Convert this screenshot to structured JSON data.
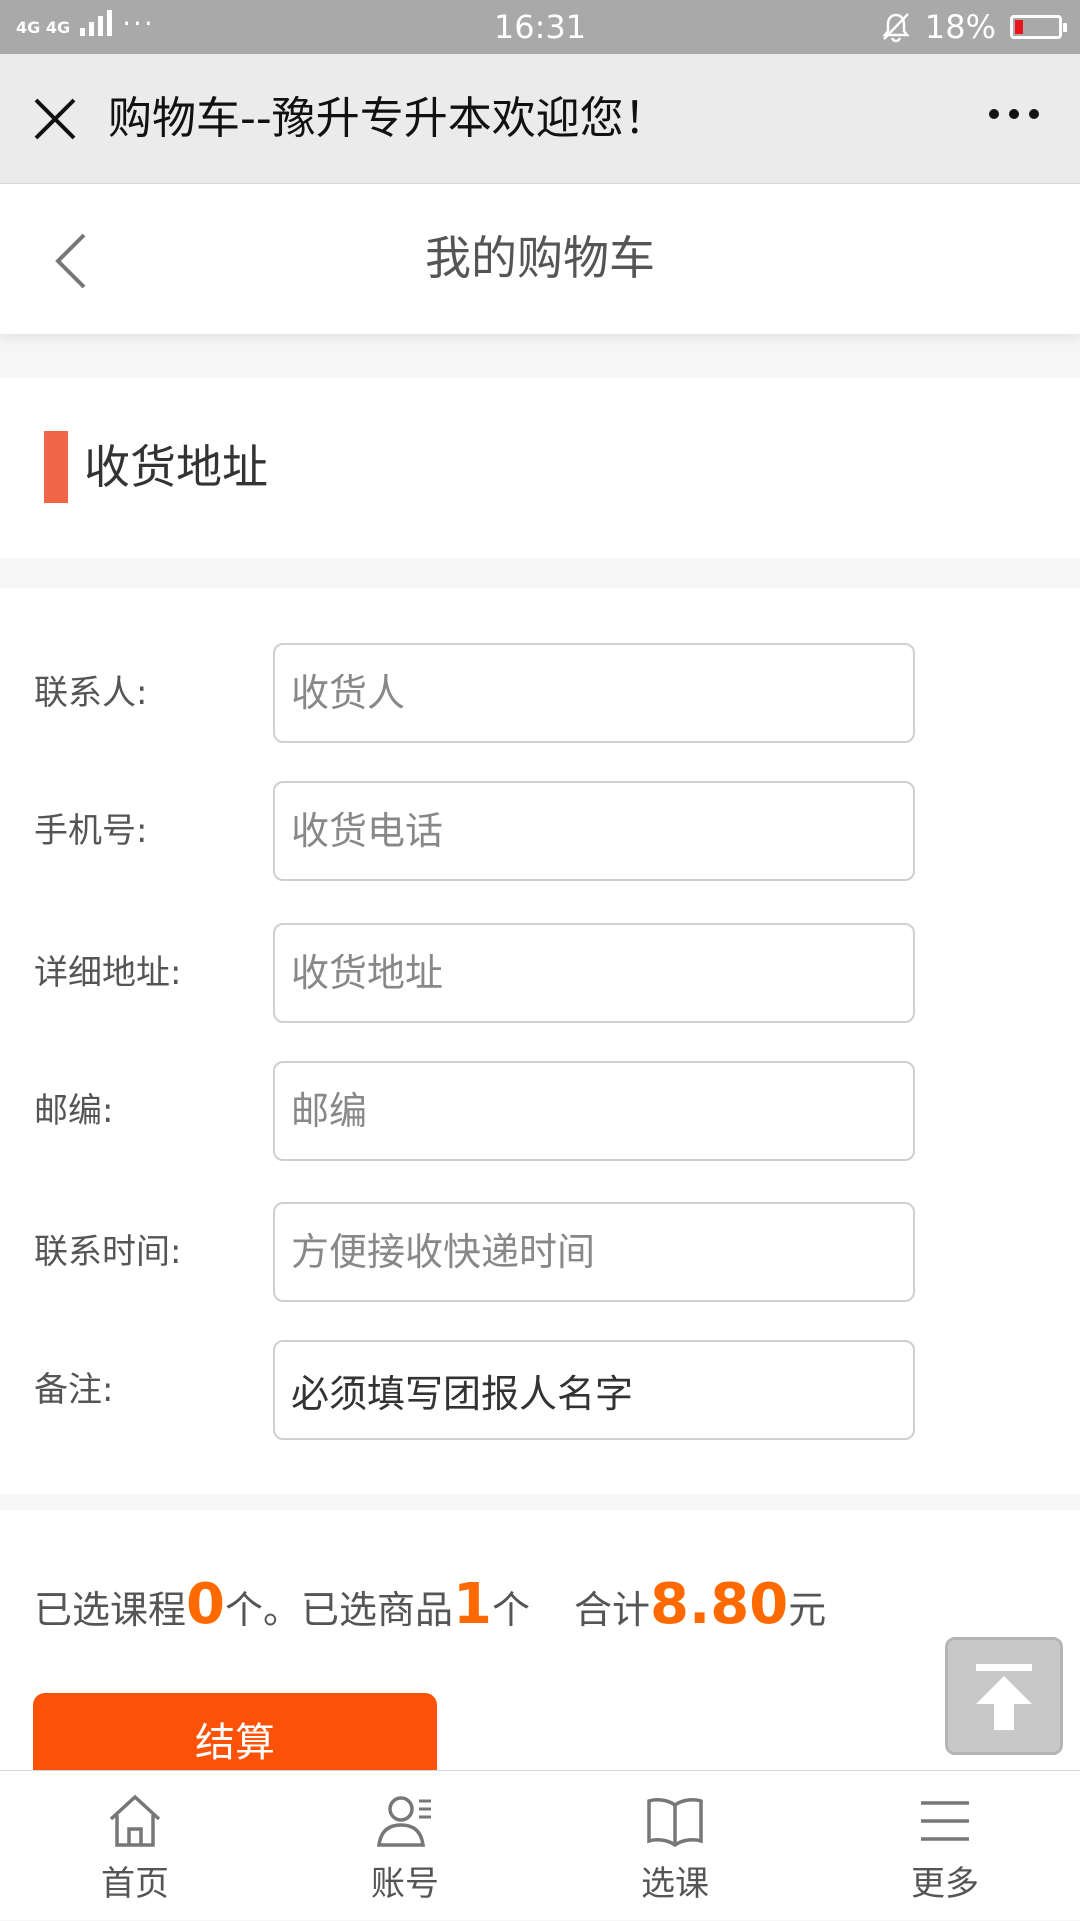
{
  "status_bar": {
    "network": "4G 4G",
    "more": "···",
    "time": "16:31",
    "battery_pct": "18%",
    "battery_level": 0.18
  },
  "titlebar": {
    "title": "购物车--豫升专升本欢迎您！"
  },
  "header": {
    "title": "我的购物车"
  },
  "section": {
    "title": "收货地址",
    "accent_color": "#ef6746"
  },
  "form": {
    "fields": [
      {
        "label": "联系人:",
        "placeholder": "收货人",
        "value": ""
      },
      {
        "label": "手机号:",
        "placeholder": "收货电话",
        "value": ""
      },
      {
        "label": "详细地址:",
        "placeholder": "收货地址",
        "value": ""
      },
      {
        "label": "邮编:",
        "placeholder": "邮编",
        "value": ""
      },
      {
        "label": "联系时间:",
        "placeholder": "方便接收快递时间",
        "value": ""
      },
      {
        "label": "备注:",
        "placeholder": "",
        "value": "必须填写团报人名字"
      }
    ]
  },
  "summary": {
    "courses_prefix": "已选课程",
    "courses_count": "0",
    "courses_suffix": "个。",
    "goods_prefix": "已选商品",
    "goods_count": "1",
    "goods_suffix": "个",
    "total_prefix": "合计",
    "total_amount": "8.80",
    "total_suffix": "元",
    "highlight_color": "#ff6a00"
  },
  "checkout": {
    "label": "结算",
    "color": "#fc5108"
  },
  "back_to_top": {
    "icon": "arrow-up-to-top-icon"
  },
  "bottom_nav": {
    "items": [
      {
        "label": "首页",
        "icon": "home-icon"
      },
      {
        "label": "账号",
        "icon": "user-icon"
      },
      {
        "label": "选课",
        "icon": "book-icon"
      },
      {
        "label": "更多",
        "icon": "menu-icon"
      }
    ]
  }
}
